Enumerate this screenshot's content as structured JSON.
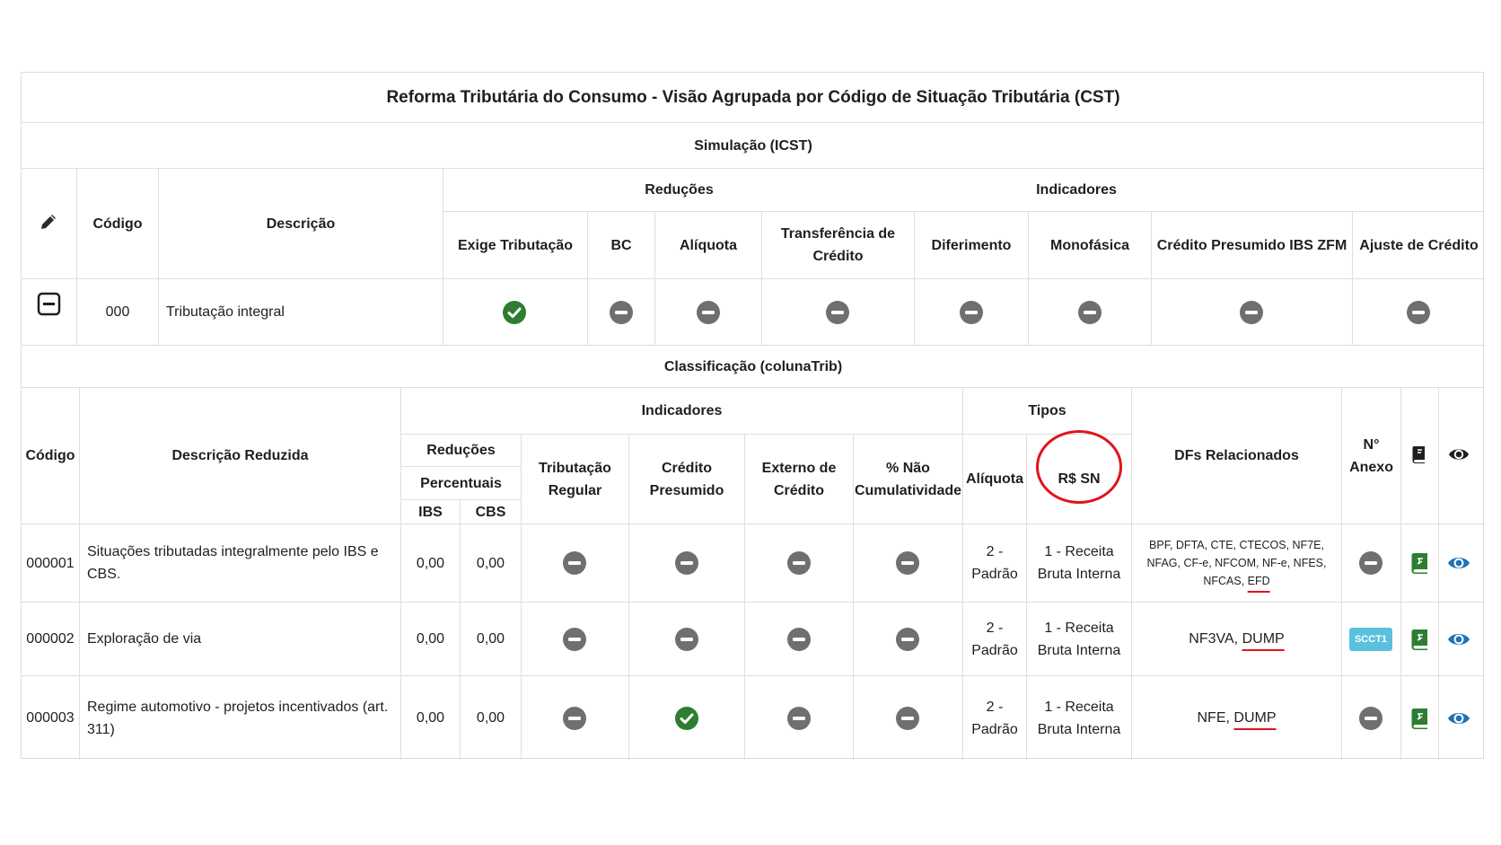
{
  "title": "Reforma Tributária do Consumo - Visão Agrupada por Código de Situação Tributária (CST)",
  "simulacao": {
    "title": "Simulação (ICST)",
    "headers": {
      "codigo": "Código",
      "descricao": "Descrição",
      "reducoes": "Reduções",
      "indicadores": "Indicadores",
      "exige_tributacao": "Exige Tributação",
      "bc": "BC",
      "aliquota": "Alíquota",
      "transferencia": "Transferência de Crédito",
      "diferimento": "Diferimento",
      "monofasica": "Monofásica",
      "credito_presumido_zfm": "Crédito Presumido IBS ZFM",
      "ajuste_credito": "Ajuste de Crédito"
    },
    "row": {
      "codigo": "000",
      "descricao": "Tributação integral",
      "exige_tributacao": "check",
      "bc": "minus",
      "aliquota": "minus",
      "transferencia": "minus",
      "diferimento": "minus",
      "monofasica": "minus",
      "credito_presumido_zfm": "minus",
      "ajuste_credito": "minus"
    }
  },
  "classificacao": {
    "title": "Classificação (colunaTrib)",
    "headers": {
      "codigo": "Código",
      "descricao_reduzida": "Descrição Reduzida",
      "indicadores": "Indicadores",
      "tipos": "Tipos",
      "reducoes": "Reduções",
      "percentuais": "Percentuais",
      "ibs": "IBS",
      "cbs": "CBS",
      "tributacao_regular": "Tributação Regular",
      "credito_presumido": "Crédito Presumido",
      "externo_credito": "Externo de Crédito",
      "nao_cumulatividade": "% Não Cumulatividade",
      "aliquota": "Alíquota",
      "rs_sn": "R$ SN",
      "dfs_relacionados": "DFs Relacionados",
      "n_anexo": "N° Anexo"
    },
    "rows": [
      {
        "codigo": "000001",
        "descricao": "Situações tributadas integralmente pelo IBS e CBS.",
        "ibs": "0,00",
        "cbs": "0,00",
        "tributacao_regular": "minus",
        "credito_presumido": "minus",
        "externo_credito": "minus",
        "nao_cumulatividade": "minus",
        "aliquota": "2 - Padrão",
        "rs_sn": "1 - Receita Bruta Interna",
        "dfs_prefix": "BPF, DFTA, CTE, CTECOS, NF7E, NFAG, CF-e, NFCOM, NF-e, NFES, NFCAS, ",
        "dfs_highlight": "EFD",
        "anexo": "minus"
      },
      {
        "codigo": "000002",
        "descricao": "Exploração de via",
        "ibs": "0,00",
        "cbs": "0,00",
        "tributacao_regular": "minus",
        "credito_presumido": "minus",
        "externo_credito": "minus",
        "nao_cumulatividade": "minus",
        "aliquota": "2 - Padrão",
        "rs_sn": "1 - Receita Bruta Interna",
        "dfs_prefix": "NF3VA, ",
        "dfs_highlight": "DUMP",
        "anexo": "SCCT1"
      },
      {
        "codigo": "000003",
        "descricao": "Regime automotivo - projetos incentivados (art. 311)",
        "ibs": "0,00",
        "cbs": "0,00",
        "tributacao_regular": "minus",
        "credito_presumido": "check",
        "externo_credito": "minus",
        "nao_cumulatividade": "minus",
        "aliquota": "2 - Padrão",
        "rs_sn": "1 - Receita Bruta Interna",
        "dfs_prefix": "NFE, ",
        "dfs_highlight": "DUMP",
        "anexo": "minus"
      }
    ]
  },
  "colors": {
    "check": "#2e7d32",
    "minus": "#6f6f6f",
    "book_green": "#2e7d32",
    "eye_blue": "#1f73b7",
    "badge": "#5bc0de",
    "annotation_red": "#e0141b"
  }
}
